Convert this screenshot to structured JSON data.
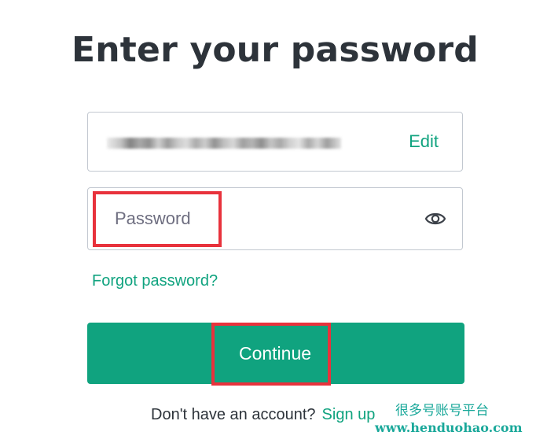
{
  "heading": {
    "title": "Enter your password"
  },
  "email_field": {
    "masked_value": "",
    "edit_label": "Edit"
  },
  "password_field": {
    "value": "",
    "placeholder": "Password",
    "toggle_icon": "eye-icon"
  },
  "links": {
    "forgot_password": "Forgot password?"
  },
  "actions": {
    "continue_label": "Continue"
  },
  "signup": {
    "prompt": "Don't have an account?",
    "link_label": "Sign up"
  },
  "watermark": {
    "cn_text": "很多号账号平台",
    "url": "www.henduohao.com"
  },
  "colors": {
    "accent": "#10a37f",
    "highlight": "#e8323c",
    "border": "#c2c8d0",
    "text": "#2d333a"
  }
}
